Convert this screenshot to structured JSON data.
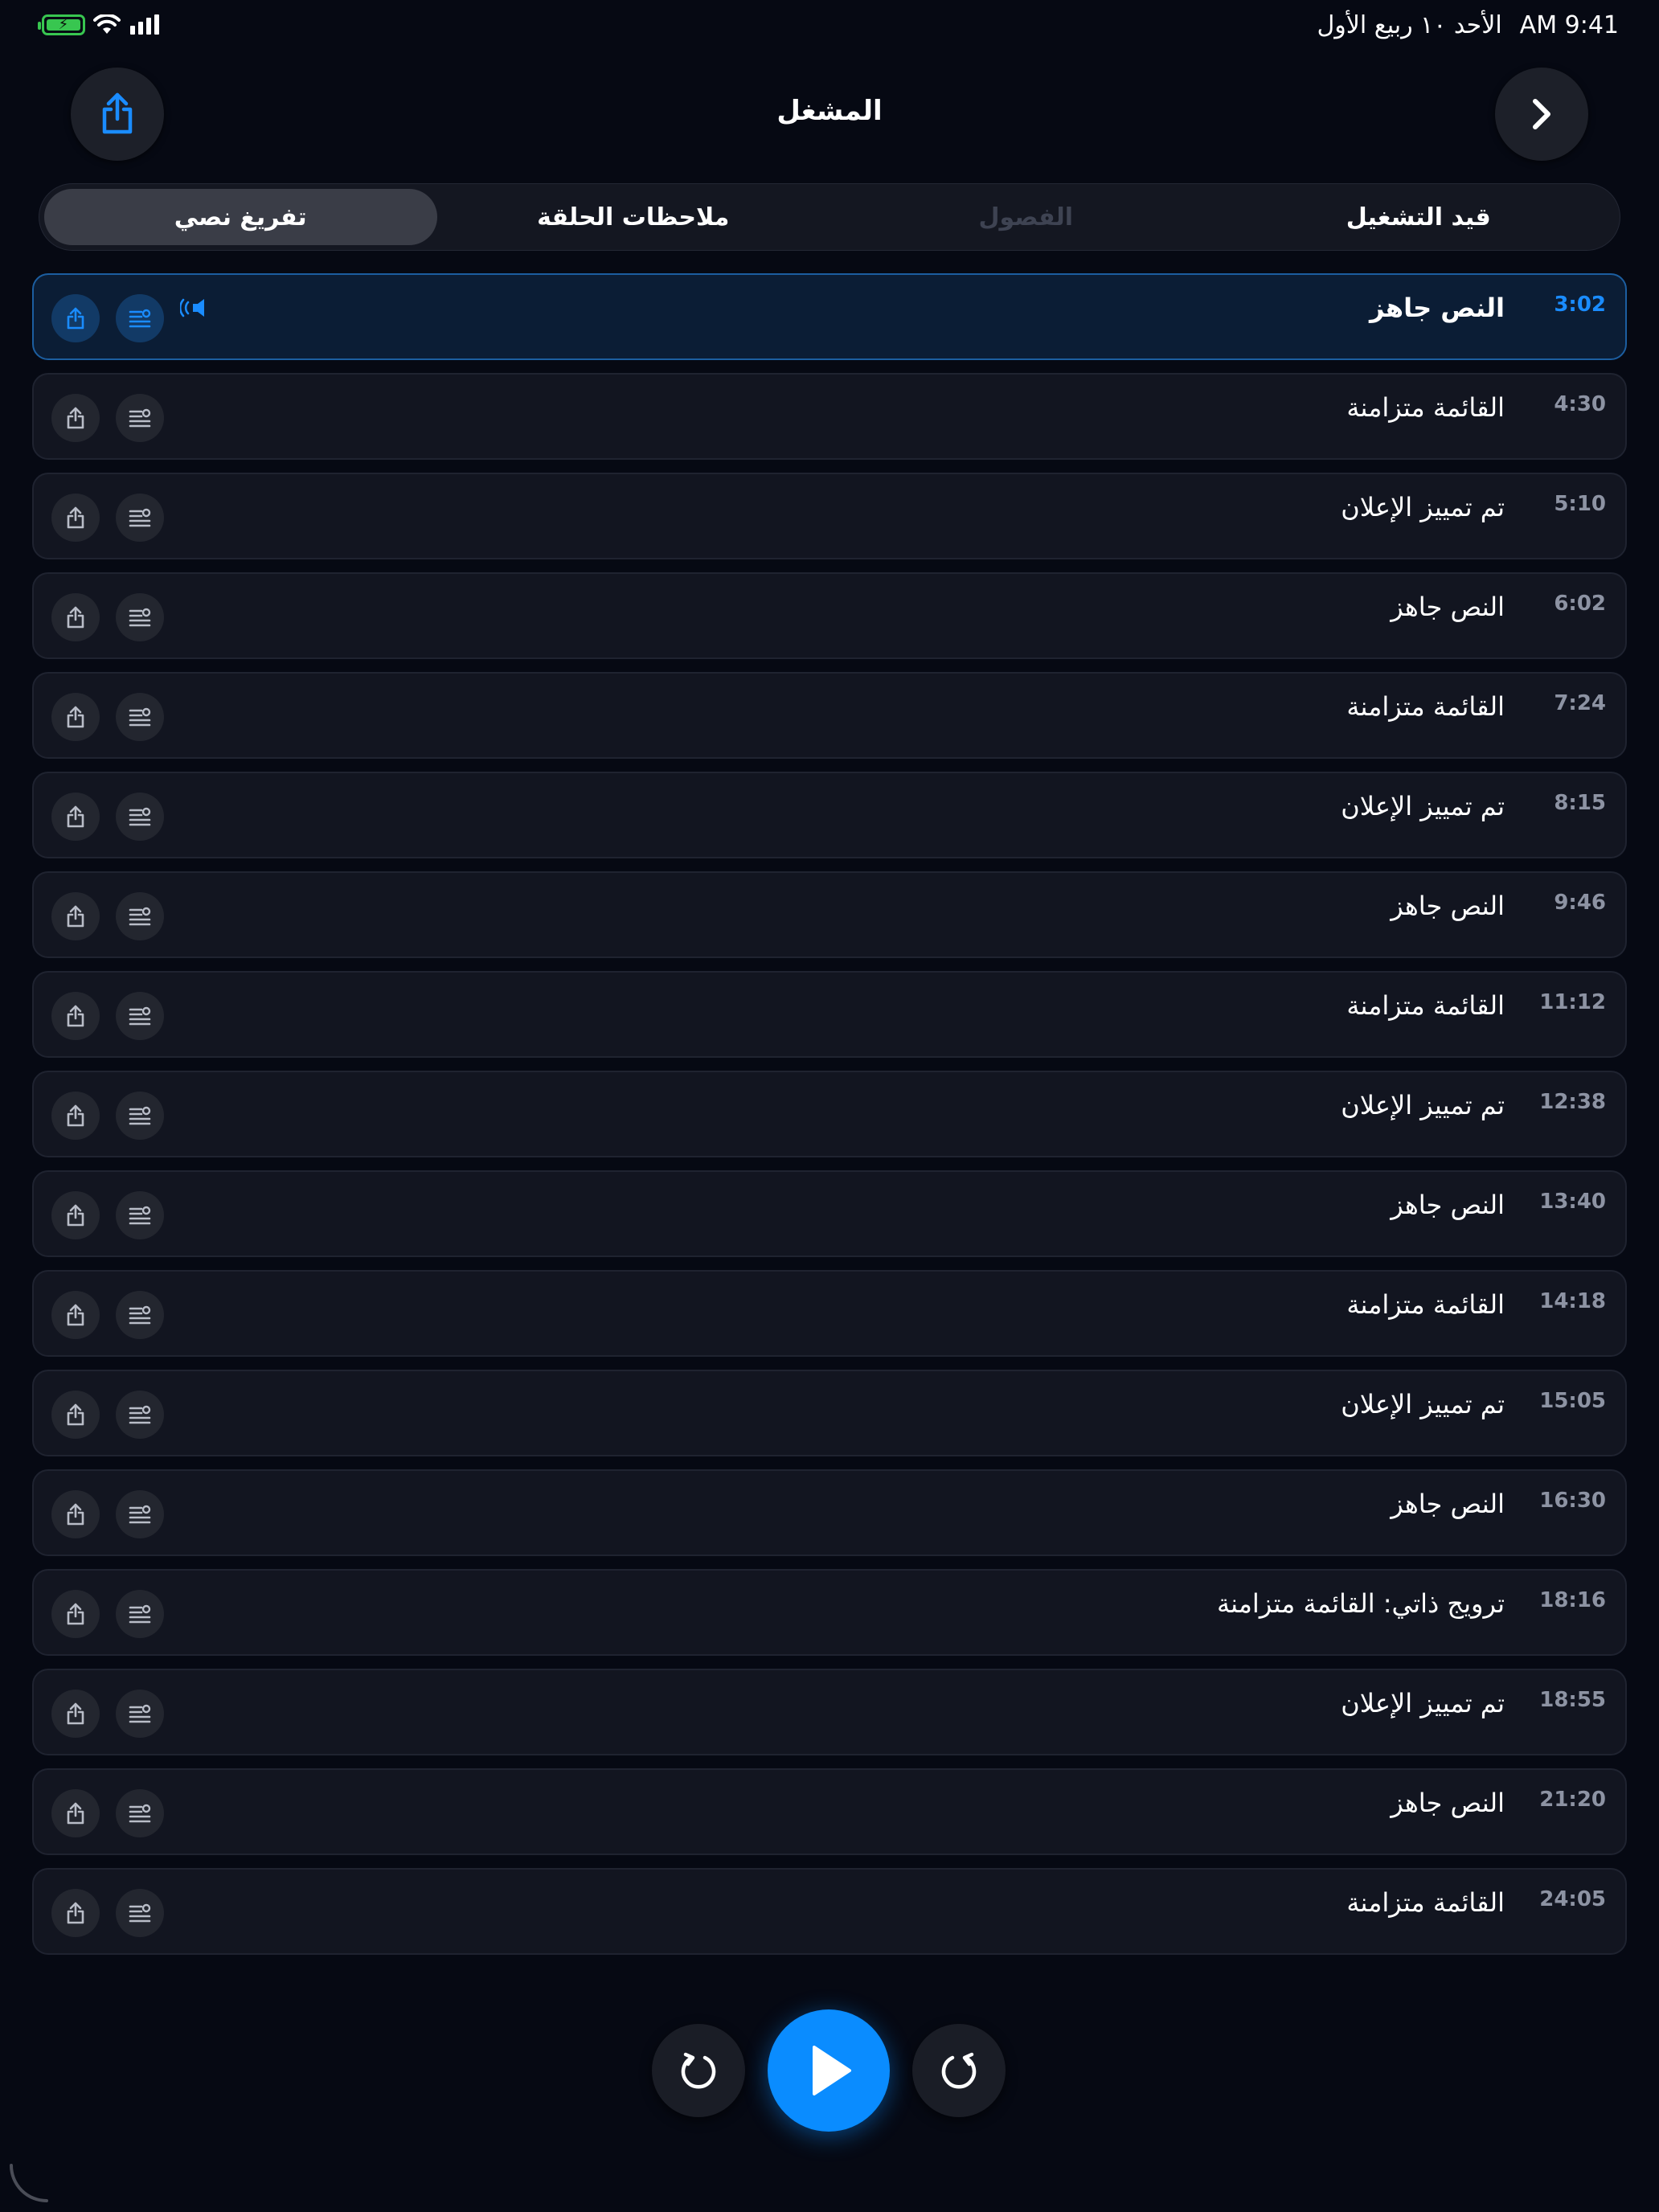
{
  "status_bar": {
    "time": "9:41 AM",
    "date": "الأحد ١٠ ربيع الأول"
  },
  "header": {
    "title": "المشغل"
  },
  "tabs": [
    {
      "label": "قيد التشغيل",
      "state": "normal"
    },
    {
      "label": "الفصول",
      "state": "disabled"
    },
    {
      "label": "ملاحظات الحلقة",
      "state": "normal"
    },
    {
      "label": "تفريغ نصي",
      "state": "selected"
    }
  ],
  "rows": [
    {
      "time": "3:02",
      "title": "النص جاهز"
    },
    {
      "time": "4:30",
      "title": "القائمة متزامنة"
    },
    {
      "time": "5:10",
      "title": "تم تمييز الإعلان"
    },
    {
      "time": "6:02",
      "title": "النص جاهز"
    },
    {
      "time": "7:24",
      "title": "القائمة متزامنة"
    },
    {
      "time": "8:15",
      "title": "تم تمييز الإعلان"
    },
    {
      "time": "9:46",
      "title": "النص جاهز"
    },
    {
      "time": "11:12",
      "title": "القائمة متزامنة"
    },
    {
      "time": "12:38",
      "title": "تم تمييز الإعلان"
    },
    {
      "time": "13:40",
      "title": "النص جاهز"
    },
    {
      "time": "14:18",
      "title": "القائمة متزامنة"
    },
    {
      "time": "15:05",
      "title": "تم تمييز الإعلان"
    },
    {
      "time": "16:30",
      "title": "النص جاهز"
    },
    {
      "time": "18:16",
      "title": "ترويج ذاتي: القائمة متزامنة"
    },
    {
      "time": "18:55",
      "title": "تم تمييز الإعلان"
    },
    {
      "time": "21:20",
      "title": "النص جاهز"
    },
    {
      "time": "24:05",
      "title": "القائمة متزامنة"
    }
  ],
  "active_row": 0,
  "colors": {
    "accent": "#0a8cff",
    "background": "#060913",
    "battery": "#38c650"
  },
  "icons": {
    "header_left": "share-icon",
    "header_right": "chevron-right-icon",
    "row_share": "share-icon",
    "row_notes": "notes-list-icon",
    "now_playing": "now-playing-speaker-icon",
    "skip_back": "skip-back-icon",
    "play": "play-icon",
    "skip_forward": "skip-forward-icon"
  }
}
